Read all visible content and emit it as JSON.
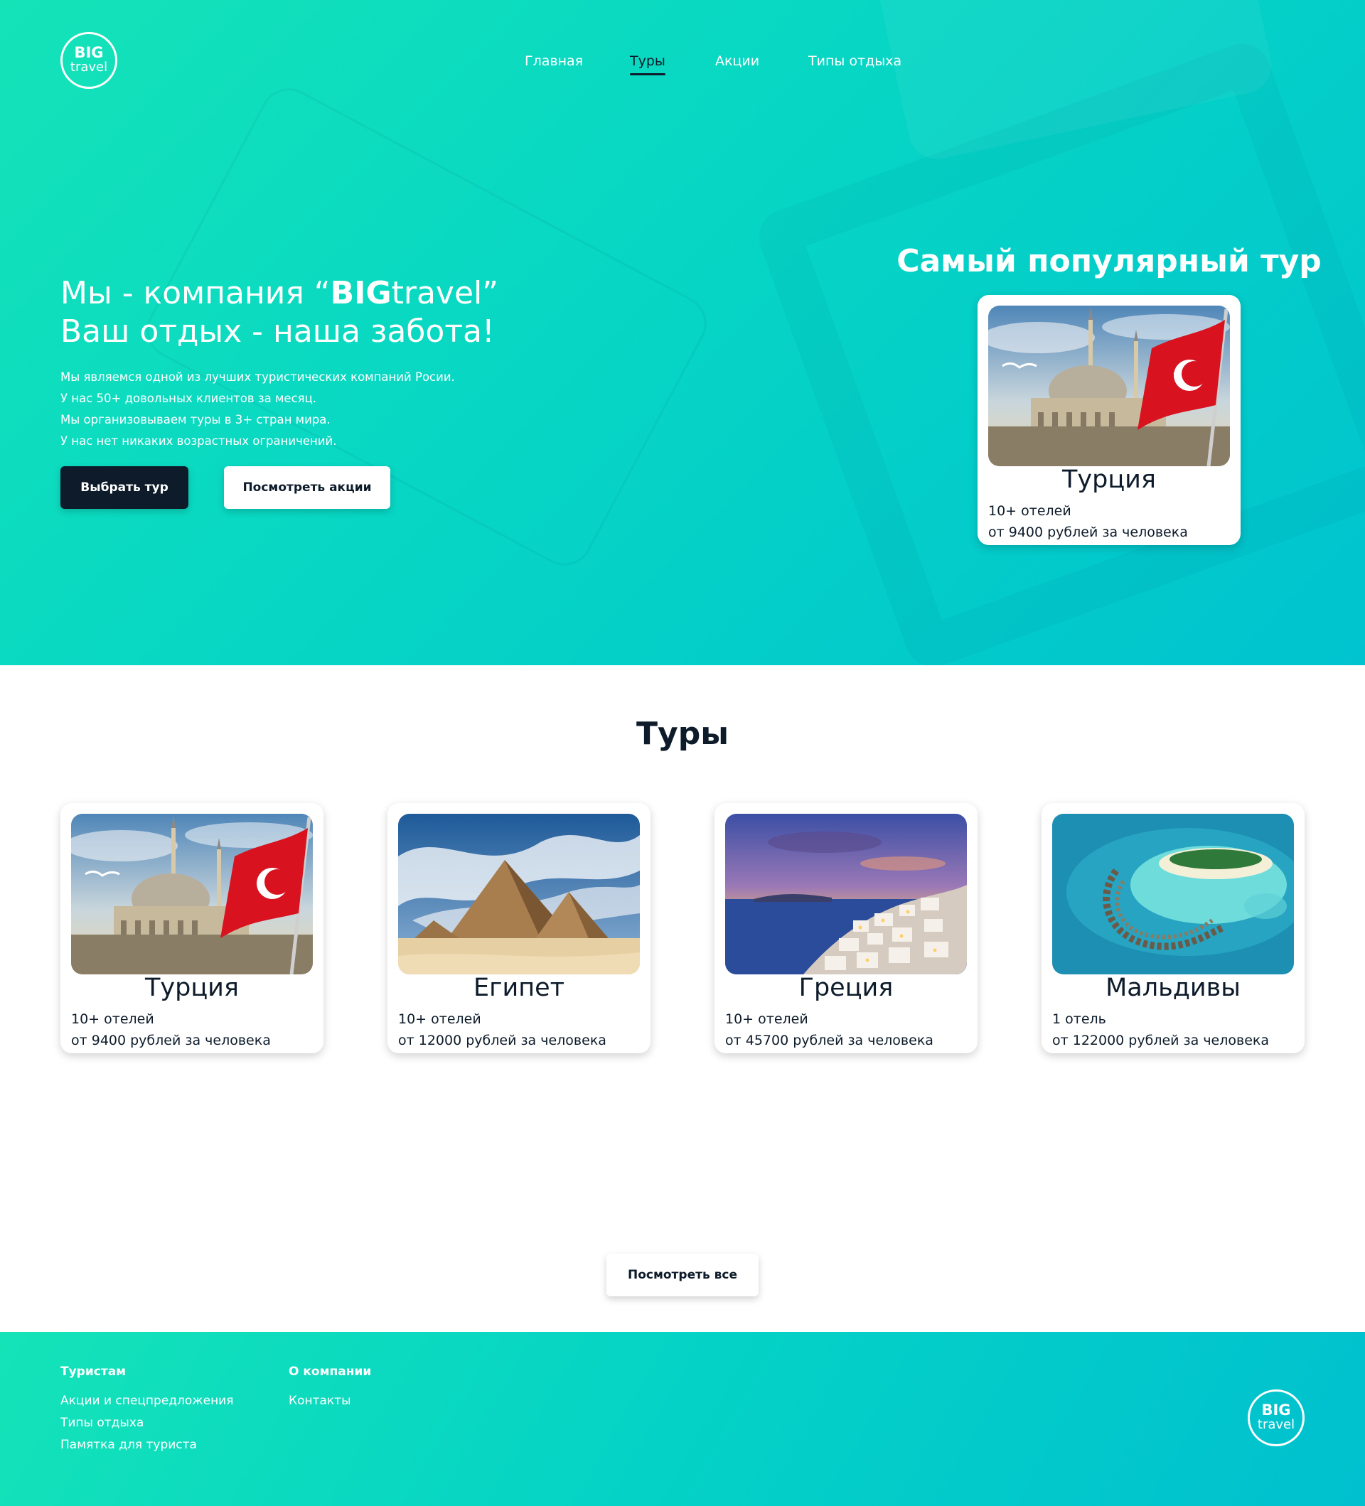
{
  "logo": {
    "line1": "BIG",
    "line2": "travel"
  },
  "nav": {
    "items": [
      {
        "label": "Главная"
      },
      {
        "label": "Туры"
      },
      {
        "label": "Акции"
      },
      {
        "label": "Типы отдыха"
      }
    ],
    "active": "Туры"
  },
  "hero": {
    "title_prefix": "Мы - компания “",
    "title_brand_bold": "BIG",
    "title_brand_rest": "travel”",
    "title_line2": "Ваш отдых - наша забота!",
    "lines": [
      "Мы являемся одной из лучших туристических компаний Росии.",
      "У нас 50+ довольных клиентов за месяц.",
      "Мы организовываем туры в 3+ стран мира.",
      "У нас нет никаких возрастных ограничений."
    ],
    "btn_choose": "Выбрать тур",
    "btn_promos": "Посмотреть акции"
  },
  "popular": {
    "title": "Самый популярный тур",
    "tour": {
      "name": "Турция",
      "hotels": "10+ отелей",
      "price": "от 9400 рублей за человека",
      "image": "turkey-mosque-photo"
    }
  },
  "tours": {
    "title": "Туры",
    "items": [
      {
        "name": "Турция",
        "hotels": "10+ отелей",
        "price": "от 9400 рублей за человека",
        "image": "turkey-mosque-photo"
      },
      {
        "name": "Египет",
        "hotels": "10+ отелей",
        "price": "от 12000 рублей за человека",
        "image": "egypt-pyramids-photo"
      },
      {
        "name": "Греция",
        "hotels": "10+ отелей",
        "price": "от 45700 рублей за человека",
        "image": "greece-santorini-photo"
      },
      {
        "name": "Мальдивы",
        "hotels": "1 отель",
        "price": "от 122000 рублей за человека",
        "image": "maldives-atoll-photo"
      }
    ],
    "btn_all": "Посмотреть все"
  },
  "footer": {
    "col1": {
      "title": "Туристам",
      "links": [
        "Акции и спецпредложения",
        "Типы отдыха",
        "Памятка для туриста"
      ]
    },
    "col2": {
      "title": "О компании",
      "links": [
        "Контакты"
      ]
    }
  },
  "colors": {
    "teal_start": "#14e3b8",
    "teal_end": "#00c3cf",
    "navy": "#0d1b2a",
    "white": "#ffffff"
  }
}
